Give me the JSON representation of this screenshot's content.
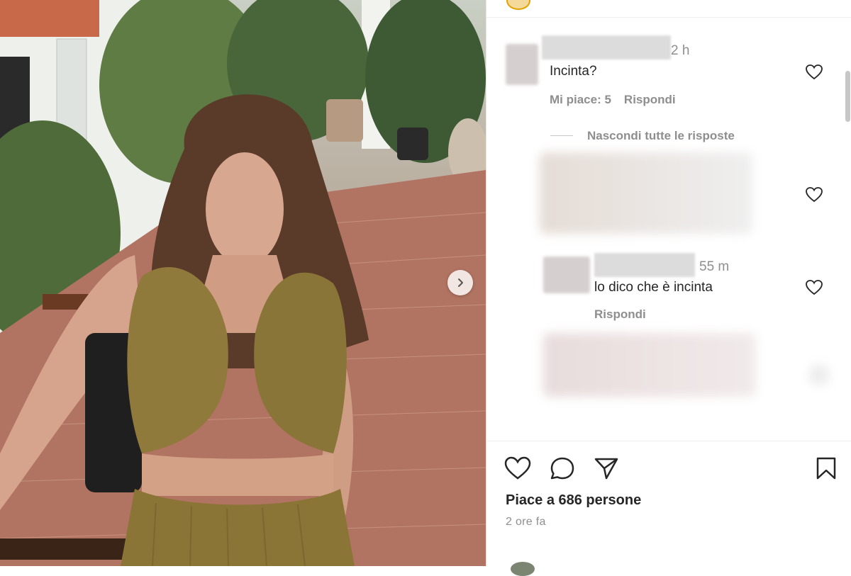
{
  "post": {
    "image": {
      "description_icon": "photo",
      "next_icon": "chevron-right-icon"
    },
    "likes_text": "Piace a 686 persone",
    "time_ago": "2 ore fa"
  },
  "comments": [
    {
      "time": "2 h",
      "text": "Incinta?",
      "likes_text": "Mi piace: 5",
      "reply_label": "Rispondi"
    },
    {
      "time": "55 m",
      "text": "lo dico che è incinta",
      "reply_label": "Rispondi"
    }
  ],
  "replies_toggle": "Nascondi tutte le risposte",
  "icons": {
    "like": "heart-icon",
    "comment": "comment-icon",
    "share": "send-icon",
    "save": "bookmark-icon"
  },
  "colors": {
    "text": "#262626",
    "muted": "#8e8e8e",
    "accent_ring": "#e2a200"
  }
}
